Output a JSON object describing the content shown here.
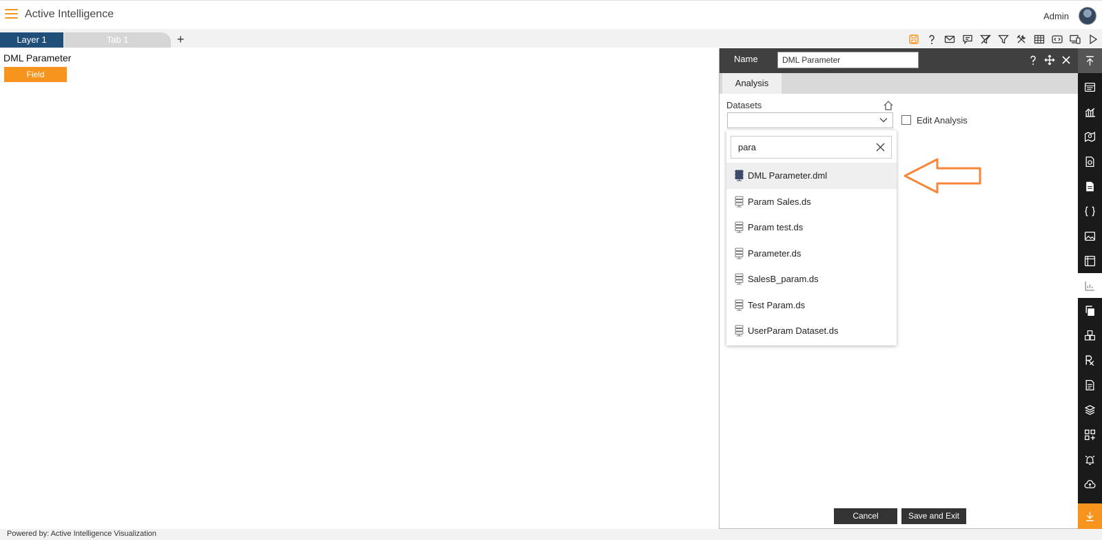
{
  "header": {
    "app_title": "Active Intelligence",
    "user_name": "Admin"
  },
  "tabs": {
    "layer_label": "Layer 1",
    "tab_label": "Tab 1",
    "add_symbol": "+"
  },
  "canvas": {
    "widget_title": "DML Parameter",
    "field_label": "Field"
  },
  "panel": {
    "name_label": "Name",
    "name_value": "DML Parameter",
    "tab_analysis": "Analysis",
    "datasets_label": "Datasets",
    "dataset_selected": "",
    "edit_analysis_label": "Edit Analysis",
    "edit_analysis_checked": false,
    "cancel_label": "Cancel",
    "save_label": "Save and Exit"
  },
  "dropdown": {
    "search_value": "para",
    "items": [
      {
        "label": "DML Parameter.dml",
        "selected": true
      },
      {
        "label": "Param Sales.ds",
        "selected": false
      },
      {
        "label": "Param test.ds",
        "selected": false
      },
      {
        "label": "Parameter.ds",
        "selected": false
      },
      {
        "label": "SalesB_param.ds",
        "selected": false
      },
      {
        "label": "Test Param.ds",
        "selected": false
      },
      {
        "label": "UserParam Dataset.ds",
        "selected": false
      }
    ]
  },
  "footer": {
    "text": "Powered by: Active Intelligence Visualization"
  },
  "colors": {
    "accent": "#f7941d",
    "layer_tab": "#1f4e79",
    "panel_header": "#404040",
    "rail": "#1a1a1a"
  }
}
